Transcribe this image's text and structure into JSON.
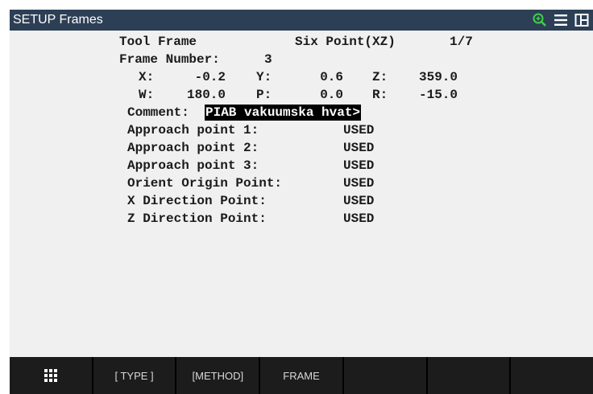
{
  "window": {
    "title": "SETUP Frames",
    "icons": [
      "zoom-in-icon",
      "hamburger-menu-icon",
      "split-view-icon"
    ]
  },
  "frame": {
    "header_type": "Tool Frame",
    "header_method": "Six Point(XZ)",
    "header_page": "1/7",
    "number_label": "Frame Number:",
    "number_value": "3",
    "coords": {
      "x_label": "X:",
      "x_value": "-0.2",
      "y_label": "Y:",
      "y_value": "0.6",
      "z_label": "Z:",
      "z_value": "359.0",
      "w_label": "W:",
      "w_value": "180.0",
      "p_label": "P:",
      "p_value": "0.0",
      "r_label": "R:",
      "r_value": "-15.0"
    },
    "comment_label": "Comment:",
    "comment_value": "PIAB vakuumska hvat>",
    "points": [
      {
        "label": "Approach point 1:",
        "status": "USED"
      },
      {
        "label": "Approach point 2:",
        "status": "USED"
      },
      {
        "label": "Approach point 3:",
        "status": "USED"
      },
      {
        "label": "Orient Origin Point:",
        "status": "USED"
      },
      {
        "label": "X Direction Point:",
        "status": "USED"
      },
      {
        "label": "Z Direction Point:",
        "status": "USED"
      }
    ]
  },
  "softkeys": {
    "f0_icon": "grid-menu-icon",
    "f1": "[ TYPE ]",
    "f2": "[METHOD]",
    "f3": "FRAME",
    "f4": "",
    "f5": "",
    "f6": ""
  },
  "colors": {
    "titlebar": "#2c3f55",
    "content_bg": "#f0f0f0",
    "softkey_bg": "#1c1c1c",
    "zoom_icon": "#3fcf4a"
  }
}
